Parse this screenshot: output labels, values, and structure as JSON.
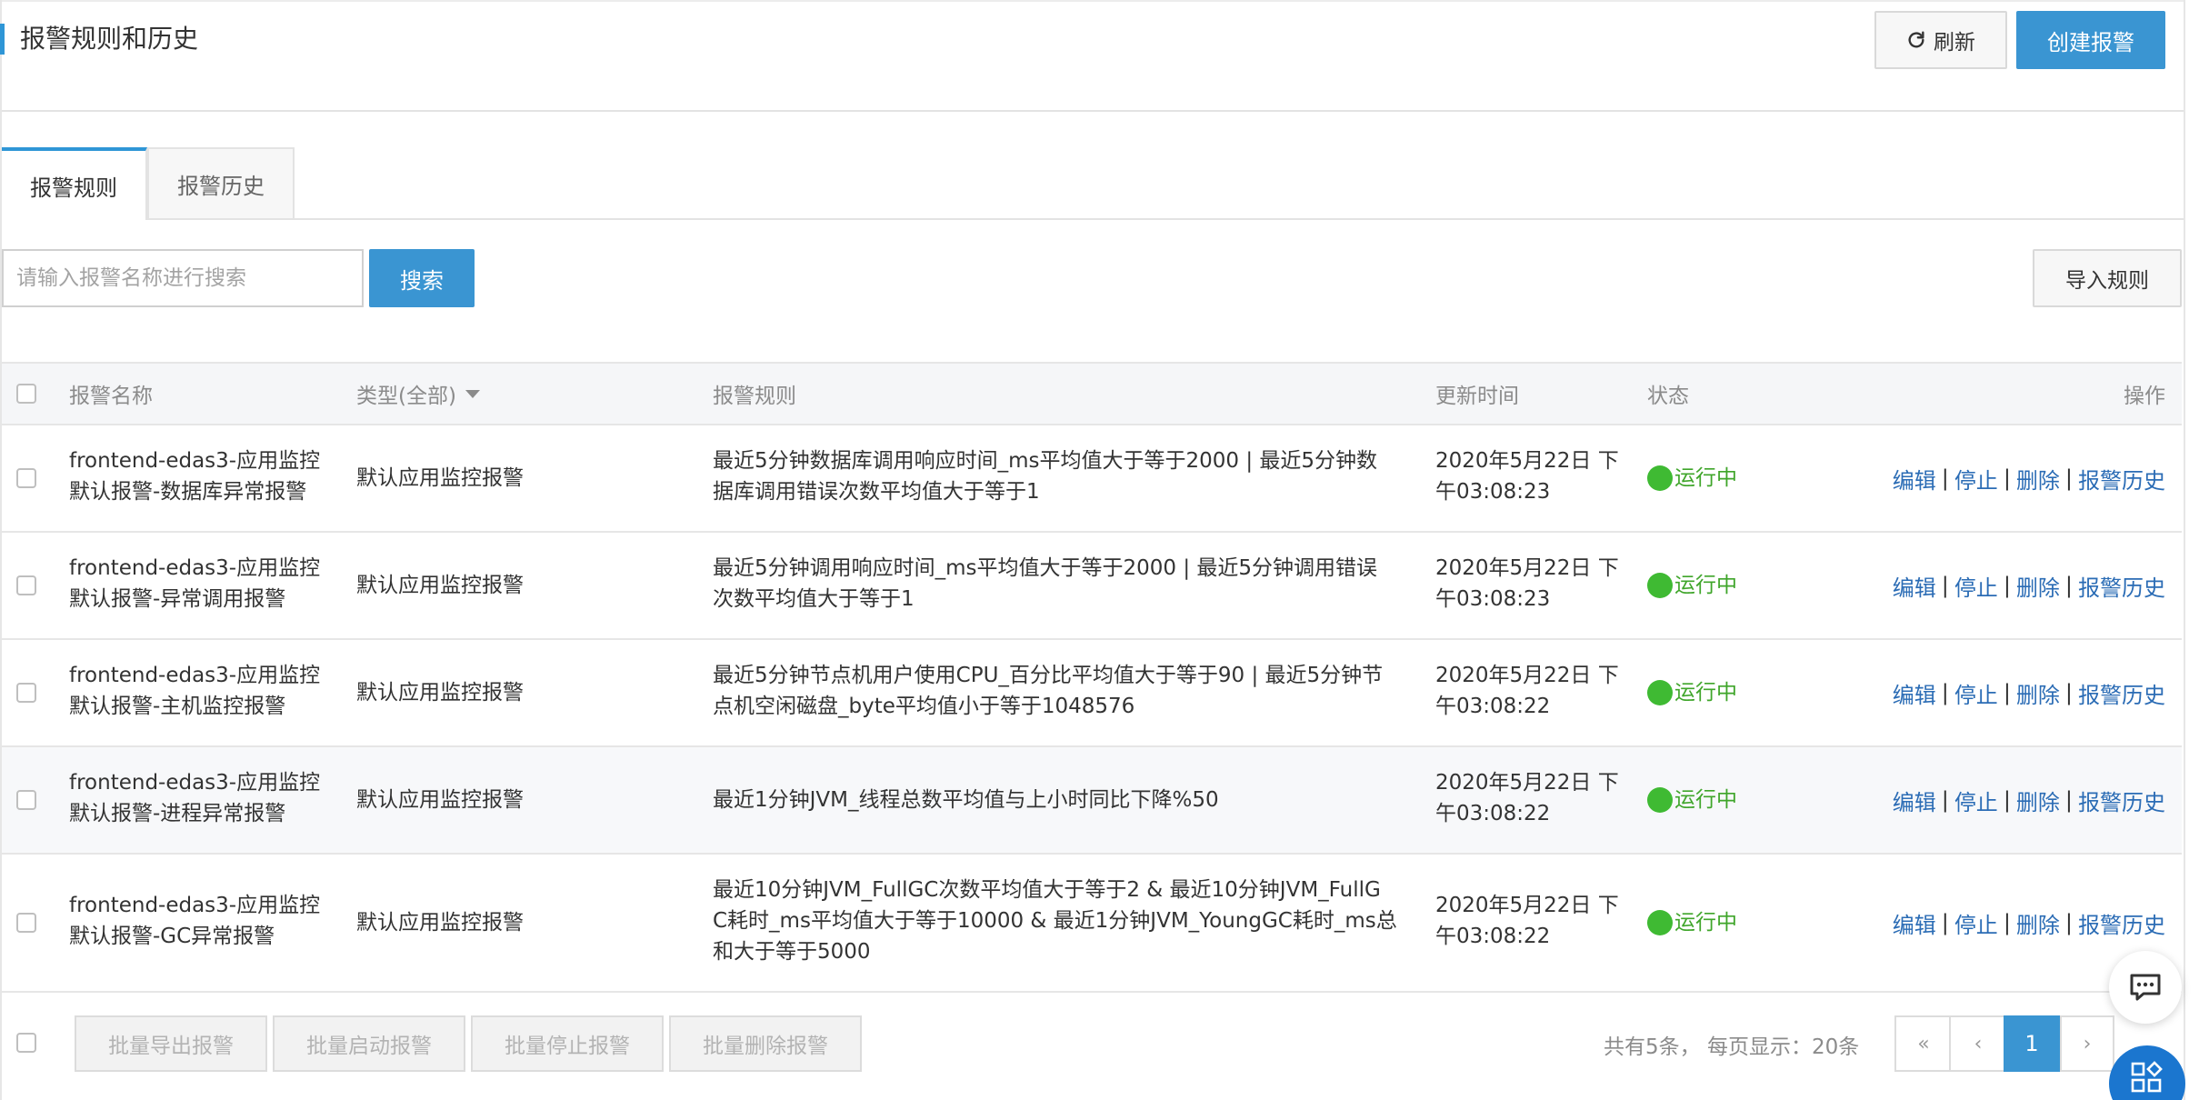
{
  "header": {
    "title": "报警规则和历史",
    "refresh_label": "刷新",
    "create_label": "创建报警"
  },
  "tabs": [
    {
      "label": "报警规则",
      "active": true
    },
    {
      "label": "报警历史",
      "active": false
    }
  ],
  "search": {
    "placeholder": "请输入报警名称进行搜索",
    "value": "",
    "button_label": "搜索",
    "import_label": "导入规则"
  },
  "table": {
    "columns": {
      "name": "报警名称",
      "type": "类型(全部)",
      "rule": "报警规则",
      "updated": "更新时间",
      "status": "状态",
      "ops": "操作"
    },
    "rows": [
      {
        "name_line1": "frontend-edas3-应用监控",
        "name_line2": "默认报警-数据库异常报警",
        "type": "默认应用监控报警",
        "rule_lines": [
          "最近5分钟数据库调用响应时间_ms平均值大于等于2000 | 最近5分钟数",
          "据库调用错误次数平均值大于等于1"
        ],
        "time_line1": "2020年5月22日 下",
        "time_line2": "午03:08:23",
        "status": "运行中"
      },
      {
        "name_line1": "frontend-edas3-应用监控",
        "name_line2": "默认报警-异常调用报警",
        "type": "默认应用监控报警",
        "rule_lines": [
          "最近5分钟调用响应时间_ms平均值大于等于2000 | 最近5分钟调用错误",
          "次数平均值大于等于1"
        ],
        "time_line1": "2020年5月22日 下",
        "time_line2": "午03:08:23",
        "status": "运行中"
      },
      {
        "name_line1": "frontend-edas3-应用监控",
        "name_line2": "默认报警-主机监控报警",
        "type": "默认应用监控报警",
        "rule_lines": [
          "最近5分钟节点机用户使用CPU_百分比平均值大于等于90 | 最近5分钟节",
          "点机空闲磁盘_byte平均值小于等于1048576"
        ],
        "time_line1": "2020年5月22日 下",
        "time_line2": "午03:08:22",
        "status": "运行中"
      },
      {
        "name_line1": "frontend-edas3-应用监控",
        "name_line2": "默认报警-进程异常报警",
        "type": "默认应用监控报警",
        "rule_lines": [
          "最近1分钟JVM_线程总数平均值与上小时同比下降%50"
        ],
        "time_line1": "2020年5月22日 下",
        "time_line2": "午03:08:22",
        "status": "运行中"
      },
      {
        "name_line1": "frontend-edas3-应用监控",
        "name_line2": "默认报警-GC异常报警",
        "type": "默认应用监控报警",
        "rule_lines": [
          "最近10分钟JVM_FullGC次数平均值大于等于2 & 最近10分钟JVM_FullG",
          "C耗时_ms平均值大于等于10000 & 最近1分钟JVM_YoungGC耗时_ms总",
          "和大于等于5000"
        ],
        "time_line1": "2020年5月22日 下",
        "time_line2": "午03:08:22",
        "status": "运行中"
      }
    ],
    "actions": {
      "edit": "编辑",
      "stop": "停止",
      "delete": "删除",
      "history": "报警历史",
      "separator": "|"
    }
  },
  "footer": {
    "bulk_export": "批量导出报警",
    "bulk_start": "批量启动报警",
    "bulk_stop": "批量停止报警",
    "bulk_delete": "批量删除报警",
    "total_text": "共有5条，  每页显示：20条",
    "pager": {
      "first": "«",
      "prev": "‹",
      "current": "1",
      "next": "›"
    }
  },
  "colors": {
    "primary": "#3a95d2",
    "link": "#2b6cb5",
    "status_green": "#3fba33"
  },
  "icons": [
    "refresh-icon",
    "sort-down-icon",
    "status-dot-icon",
    "chat-icon",
    "app-grid-icon"
  ]
}
